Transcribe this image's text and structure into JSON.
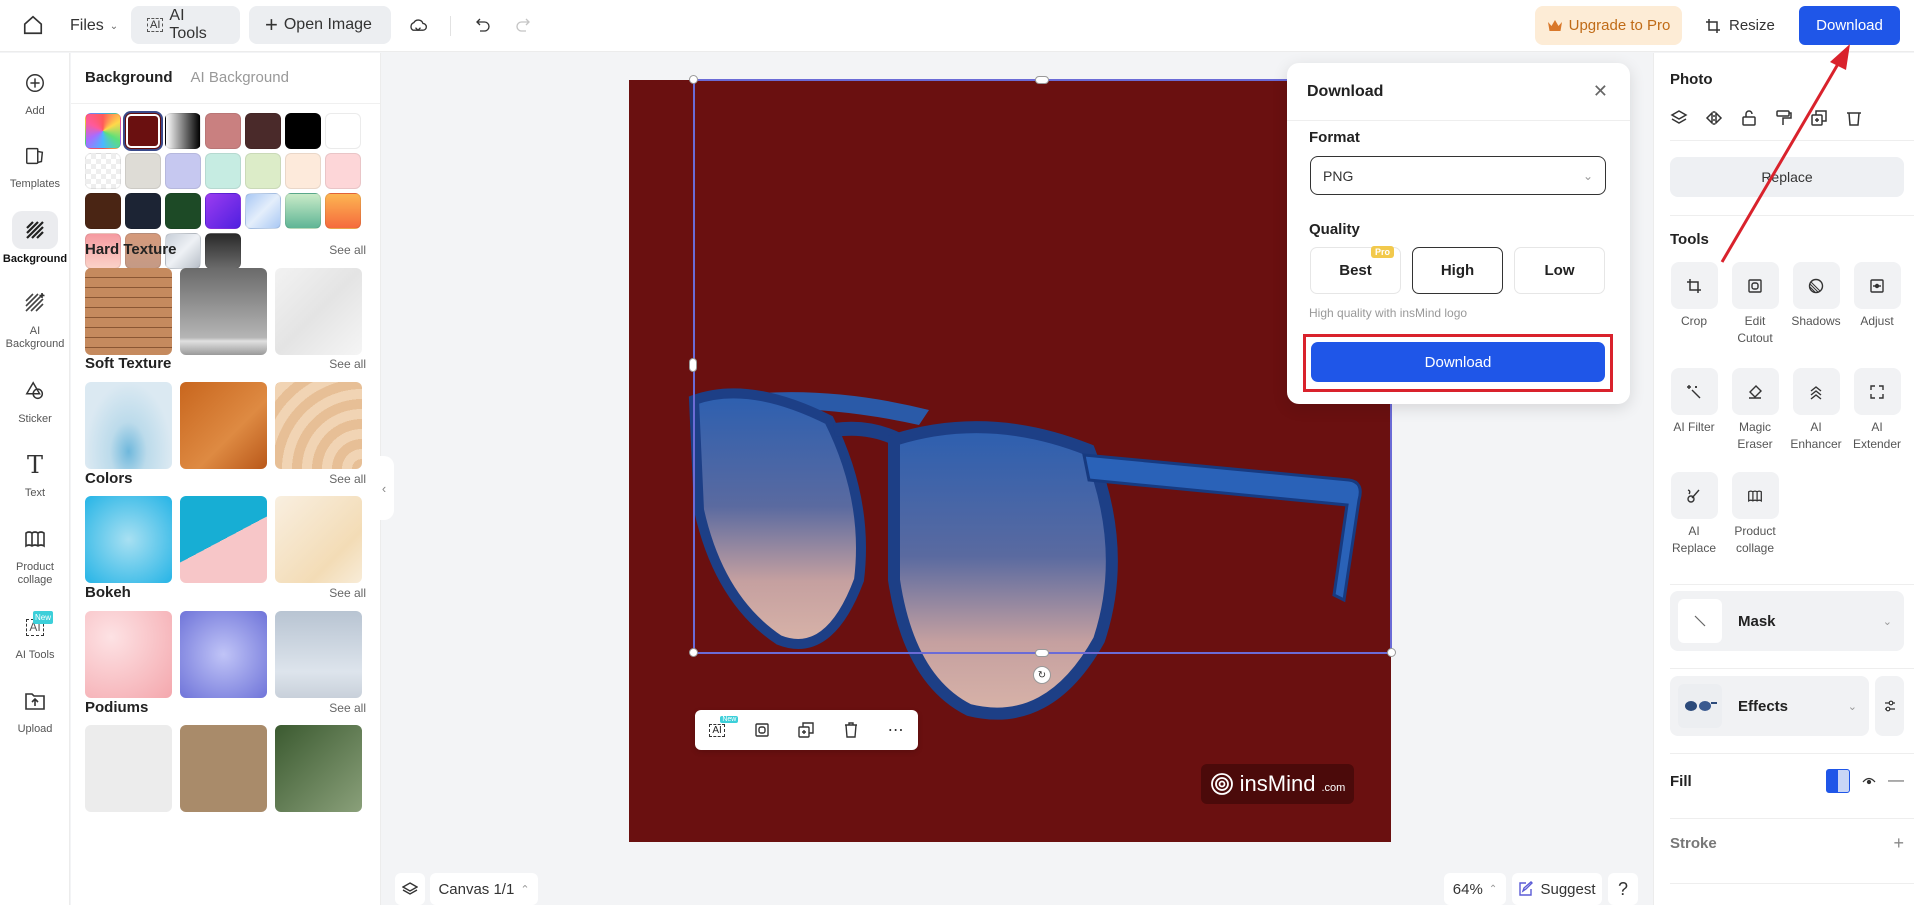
{
  "topbar": {
    "files_label": "Files",
    "ai_tools_label": "AI Tools",
    "open_image_label": "Open Image",
    "upgrade_label": "Upgrade to Pro",
    "resize_label": "Resize",
    "download_label": "Download"
  },
  "leftnav": {
    "items": [
      {
        "label": "Add",
        "icon": "plus-circle-icon"
      },
      {
        "label": "Templates",
        "icon": "templates-icon"
      },
      {
        "label": "Background",
        "icon": "background-icon",
        "active": true
      },
      {
        "label": "AI Background",
        "icon": "ai-background-icon"
      },
      {
        "label": "Sticker",
        "icon": "sticker-icon"
      },
      {
        "label": "Text",
        "icon": "text-icon"
      },
      {
        "label": "Product collage",
        "icon": "collage-icon"
      },
      {
        "label": "AI Tools",
        "icon": "ai-tools-icon",
        "badge": "New"
      },
      {
        "label": "Upload",
        "icon": "upload-icon"
      }
    ]
  },
  "panel": {
    "tab_active": "Background",
    "tab_other": "AI Background",
    "swatches": [
      "conic",
      "#6a1010",
      "grad-bw",
      "#c98080",
      "#4a2a2a",
      "#000000",
      "#ffffff",
      "transparent",
      "#dedcd6",
      "#c6c8f0",
      "#c6ece2",
      "#dcecc8",
      "#fdeadb",
      "#fdd6d8",
      "#4a2514",
      "#1c2434",
      "#1d4a26",
      "grad-purple",
      "grad-lightblue",
      "grad-mint",
      "grad-orange",
      "grad-pink",
      "grad-tan",
      "grad-silver",
      "grad-darkgray"
    ],
    "selected_swatch": 1,
    "sections": [
      {
        "title": "Hard Texture",
        "see_all": "See all",
        "thumbs": [
          "wood",
          "concrete",
          "marble"
        ]
      },
      {
        "title": "Soft Texture",
        "see_all": "See all",
        "thumbs": [
          "water-splash",
          "orange-leather",
          "cream-swirl"
        ]
      },
      {
        "title": "Colors",
        "see_all": "See all",
        "thumbs": [
          "blue-radial",
          "blue-pink-split",
          "cream-gradient"
        ]
      },
      {
        "title": "Bokeh",
        "see_all": "See all",
        "thumbs": [
          "pink-bokeh",
          "purple-bokeh",
          "silver-bokeh"
        ]
      },
      {
        "title": "Podiums",
        "see_all": "See all",
        "thumbs": [
          "white-podium",
          "tan-podium",
          "green-podium"
        ]
      }
    ]
  },
  "canvas": {
    "background_color": "#6a1010",
    "watermark_text": "insMind",
    "watermark_suffix": ".com",
    "float_toolbar_badge": "New",
    "canvas_label": "Canvas 1/1",
    "zoom_label": "64%",
    "suggest_label": "Suggest",
    "help_label": "?"
  },
  "download_popup": {
    "title": "Download",
    "format_label": "Format",
    "format_value": "PNG",
    "quality_label": "Quality",
    "quality_options": [
      "Best",
      "High",
      "Low"
    ],
    "quality_selected": "High",
    "pro_badge": "Pro",
    "hint": "High quality with insMind logo",
    "download_button": "Download"
  },
  "rpanel": {
    "photo_title": "Photo",
    "replace_label": "Replace",
    "tools_title": "Tools",
    "tools": [
      {
        "label": "Crop",
        "icon": "crop-icon"
      },
      {
        "label": "Edit Cutout",
        "icon": "edit-cutout-icon"
      },
      {
        "label": "Shadows",
        "icon": "shadows-icon"
      },
      {
        "label": "Adjust",
        "icon": "adjust-icon"
      },
      {
        "label": "AI Filter",
        "icon": "ai-filter-icon"
      },
      {
        "label": "Magic Eraser",
        "icon": "eraser-icon"
      },
      {
        "label": "AI Enhancer",
        "icon": "enhancer-icon"
      },
      {
        "label": "AI Extender",
        "icon": "extender-icon"
      },
      {
        "label": "AI Replace",
        "icon": "ai-replace-icon"
      },
      {
        "label": "Product collage",
        "icon": "collage-icon"
      }
    ],
    "mask_label": "Mask",
    "effects_label": "Effects",
    "fill_label": "Fill",
    "stroke_label": "Stroke"
  },
  "colors": {
    "accent": "#1f56e8",
    "highlight_red": "#d9222c"
  }
}
